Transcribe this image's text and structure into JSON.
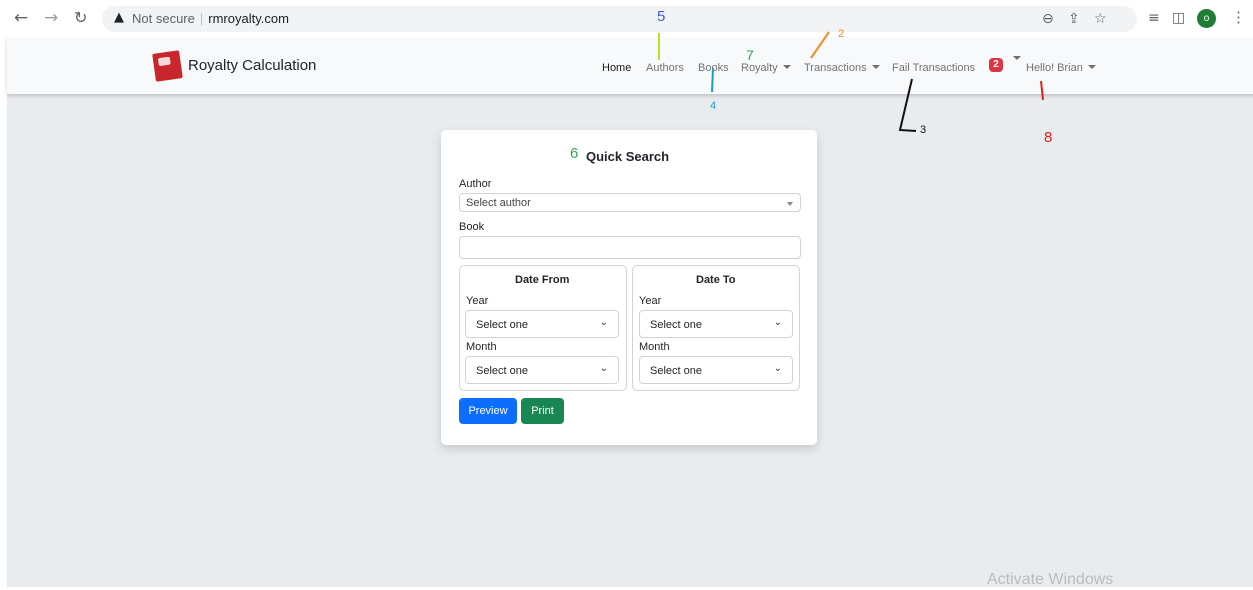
{
  "browser": {
    "security_label": "Not secure",
    "url": "rmroyalty.com",
    "profile_initial": "o"
  },
  "navbar": {
    "brand": "Royalty Calculation",
    "items": [
      {
        "label": "Home"
      },
      {
        "label": "Authors"
      },
      {
        "label": "Books"
      },
      {
        "label": "Royalty"
      },
      {
        "label": "Transactions"
      },
      {
        "label": "Fail Transactions"
      },
      {
        "label": "Hello! Brian"
      }
    ],
    "fail_badge": "2"
  },
  "search": {
    "title": "Quick Search",
    "author_label": "Author",
    "author_value": "Select author",
    "book_label": "Book",
    "book_value": "",
    "date_from": {
      "title": "Date From",
      "year_label": "Year",
      "year_value": "Select one",
      "month_label": "Month",
      "month_value": "Select one"
    },
    "date_to": {
      "title": "Date To",
      "year_label": "Year",
      "year_value": "Select one",
      "month_label": "Month",
      "month_value": "Select one"
    },
    "preview_label": "Preview",
    "print_label": "Print"
  },
  "annotations": {
    "n1": "2",
    "n2": "3",
    "n3": "4",
    "n4": "5",
    "n5": "6",
    "n6": "7",
    "n7": "8",
    "colors": {
      "blue": "#3b5bdb",
      "orange": "#f08c28",
      "cyan": "#1c9bd6",
      "green": "#3aa356",
      "lime": "#b5e02c",
      "red": "#e02020",
      "black": "#111111"
    }
  },
  "watermark": "Activate Windows"
}
